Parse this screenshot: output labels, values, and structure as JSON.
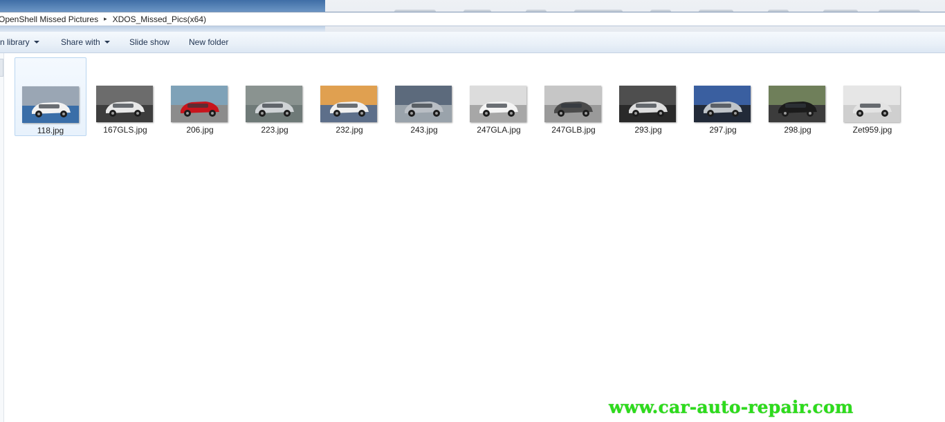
{
  "address_bar": {
    "crumbs": [
      "OpenShell Missed Pictures",
      "XDOS_Missed_Pics(x64)"
    ],
    "separator": "▸"
  },
  "toolbar": {
    "include_in_library_label": "n library",
    "share_with_label": "Share with",
    "slide_show_label": "Slide show",
    "new_folder_label": "New folder"
  },
  "files": [
    {
      "name": "118.jpg",
      "selected": true
    },
    {
      "name": "167GLS.jpg",
      "selected": false
    },
    {
      "name": "206.jpg",
      "selected": false
    },
    {
      "name": "223.jpg",
      "selected": false
    },
    {
      "name": "232.jpg",
      "selected": false
    },
    {
      "name": "243.jpg",
      "selected": false
    },
    {
      "name": "247GLA.jpg",
      "selected": false
    },
    {
      "name": "247GLB.jpg",
      "selected": false
    },
    {
      "name": "293.jpg",
      "selected": false
    },
    {
      "name": "297.jpg",
      "selected": false
    },
    {
      "name": "298.jpg",
      "selected": false
    },
    {
      "name": "Zet959.jpg",
      "selected": false
    }
  ],
  "thumbnails": [
    {
      "sky": "#9aa6b4",
      "ground": "#3a6ea8",
      "car": "#f2f2f2"
    },
    {
      "sky": "#6c6c6c",
      "ground": "#3d3d3d",
      "car": "#e8e8e8"
    },
    {
      "sky": "#7fa2b8",
      "ground": "#8c8c8c",
      "car": "#c8141c"
    },
    {
      "sky": "#8a9390",
      "ground": "#6f7a78",
      "car": "#cfd3d6"
    },
    {
      "sky": "#e0a050",
      "ground": "#5d6f8a",
      "car": "#f0f0f0"
    },
    {
      "sky": "#5c6a7c",
      "ground": "#9aa3ab",
      "car": "#b9bec4"
    },
    {
      "sky": "#dcdcdc",
      "ground": "#a7a7a7",
      "car": "#f4f4f4"
    },
    {
      "sky": "#c6c6c6",
      "ground": "#9a9a9a",
      "car": "#4b4b4b"
    },
    {
      "sky": "#4e4e4e",
      "ground": "#2a2a2a",
      "car": "#dedede"
    },
    {
      "sky": "#3a5fa0",
      "ground": "#222a38",
      "car": "#bfc4c9"
    },
    {
      "sky": "#6f7f5a",
      "ground": "#3c3c3c",
      "car": "#1b1b1b"
    },
    {
      "sky": "#e6e6e6",
      "ground": "#cfcfcf",
      "car": "#e3e3e3"
    }
  ],
  "watermark": "www.car-auto-repair.com"
}
